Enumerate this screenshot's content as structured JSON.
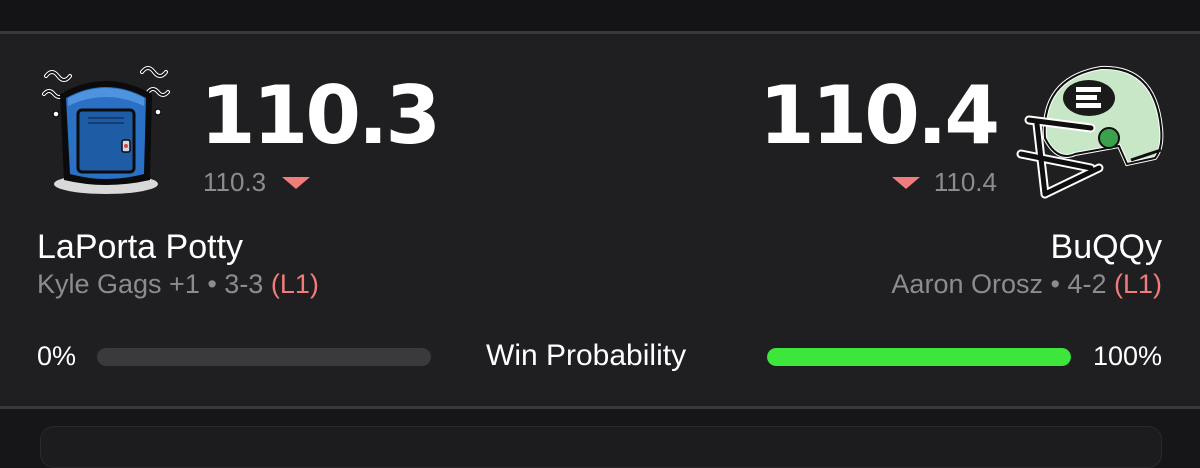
{
  "home": {
    "logo_icon": "portable-toilet-icon",
    "score": "110.3",
    "projected": "110.3",
    "team_name": "LaPorta Potty",
    "owner_record": "Kyle Gags +1 • 3-3",
    "streak": "(L1)",
    "win_probability_label": "0%",
    "win_probability": 0
  },
  "away": {
    "logo_icon": "football-helmet-icon",
    "score": "110.4",
    "projected": "110.4",
    "team_name": "BuQQy",
    "owner_record": "Aaron Orosz • 4-2",
    "streak": "(L1)",
    "win_probability_label": "100%",
    "win_probability": 100
  },
  "win_probability_title": "Win Probability",
  "colors": {
    "background": "#1f1f21",
    "trend_down": "#f27c7c",
    "win_bar": "#3ce63a",
    "bar_track": "#3a3a3d",
    "muted_text": "#8c8c90"
  }
}
